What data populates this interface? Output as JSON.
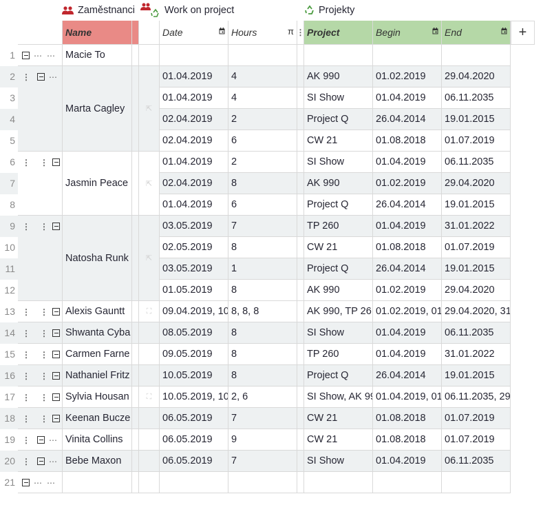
{
  "sections": {
    "employees": "Zaměstnanci",
    "work": "Work on project",
    "projects": "Projekty"
  },
  "columns": {
    "name": "Name",
    "date": "Date",
    "hours": "Hours",
    "hours_type": "π",
    "project": "Project",
    "begin": "Begin",
    "end": "End"
  },
  "add_column": "+",
  "rows": [
    {
      "num": "1",
      "name": "Macie To"
    },
    {
      "num": "2",
      "name": "Marta Cagley"
    },
    {
      "num": "3"
    },
    {
      "num": "4"
    },
    {
      "num": "5"
    },
    {
      "num": "6",
      "name": "Jasmin Peace"
    },
    {
      "num": "7"
    },
    {
      "num": "8"
    },
    {
      "num": "9",
      "name": "Natosha Runk"
    },
    {
      "num": "10"
    },
    {
      "num": "11"
    },
    {
      "num": "12"
    },
    {
      "num": "13",
      "name": "Alexis Gauntt"
    },
    {
      "num": "14",
      "name": "Shwanta Cyba"
    },
    {
      "num": "15",
      "name": "Carmen Farne"
    },
    {
      "num": "16",
      "name": "Nathaniel Fritz"
    },
    {
      "num": "17",
      "name": "Sylvia Housan"
    },
    {
      "num": "18",
      "name": "Keenan Bucze"
    },
    {
      "num": "19",
      "name": "Vinita Collins"
    },
    {
      "num": "20",
      "name": "Bebe Maxon"
    },
    {
      "num": "21"
    }
  ],
  "work": [
    {
      "date": "",
      "hours": ""
    },
    {
      "date": "01.04.2019",
      "hours": "4"
    },
    {
      "date": "01.04.2019",
      "hours": "4"
    },
    {
      "date": "02.04.2019",
      "hours": "2"
    },
    {
      "date": "02.04.2019",
      "hours": "6"
    },
    {
      "date": "01.04.2019",
      "hours": "2"
    },
    {
      "date": "02.04.2019",
      "hours": "8"
    },
    {
      "date": "01.04.2019",
      "hours": "6"
    },
    {
      "date": "03.05.2019",
      "hours": "7"
    },
    {
      "date": "02.05.2019",
      "hours": "8"
    },
    {
      "date": "03.05.2019",
      "hours": "1"
    },
    {
      "date": "01.05.2019",
      "hours": "8"
    },
    {
      "date": "09.04.2019, 10",
      "hours": "8, 8, 8"
    },
    {
      "date": "08.05.2019",
      "hours": "8"
    },
    {
      "date": "09.05.2019",
      "hours": "8"
    },
    {
      "date": "10.05.2019",
      "hours": "8"
    },
    {
      "date": "10.05.2019, 10",
      "hours": "2, 6"
    },
    {
      "date": "06.05.2019",
      "hours": "7"
    },
    {
      "date": "06.05.2019",
      "hours": "9"
    },
    {
      "date": "06.05.2019",
      "hours": "7"
    },
    {
      "date": "",
      "hours": ""
    }
  ],
  "projects": [
    {
      "project": "",
      "begin": "",
      "end": ""
    },
    {
      "project": "AK 990",
      "begin": "01.02.2019",
      "end": "29.04.2020"
    },
    {
      "project": "SI Show",
      "begin": "01.04.2019",
      "end": "06.11.2035"
    },
    {
      "project": "Project Q",
      "begin": "26.04.2014",
      "end": "19.01.2015"
    },
    {
      "project": "CW 21",
      "begin": "01.08.2018",
      "end": "01.07.2019"
    },
    {
      "project": "SI Show",
      "begin": "01.04.2019",
      "end": "06.11.2035"
    },
    {
      "project": "AK 990",
      "begin": "01.02.2019",
      "end": "29.04.2020"
    },
    {
      "project": "Project Q",
      "begin": "26.04.2014",
      "end": "19.01.2015"
    },
    {
      "project": "TP 260",
      "begin": "01.04.2019",
      "end": "31.01.2022"
    },
    {
      "project": "CW 21",
      "begin": "01.08.2018",
      "end": "01.07.2019"
    },
    {
      "project": "Project Q",
      "begin": "26.04.2014",
      "end": "19.01.2015"
    },
    {
      "project": "AK 990",
      "begin": "01.02.2019",
      "end": "29.04.2020"
    },
    {
      "project": "AK 990, TP 26",
      "begin": "01.02.2019, 01",
      "end": "29.04.2020, 31"
    },
    {
      "project": "SI Show",
      "begin": "01.04.2019",
      "end": "06.11.2035"
    },
    {
      "project": "TP 260",
      "begin": "01.04.2019",
      "end": "31.01.2022"
    },
    {
      "project": "Project Q",
      "begin": "26.04.2014",
      "end": "19.01.2015"
    },
    {
      "project": "SI Show, AK 99",
      "begin": "01.04.2019, 01",
      "end": "06.11.2035, 29"
    },
    {
      "project": "CW 21",
      "begin": "01.08.2018",
      "end": "01.07.2019"
    },
    {
      "project": "CW 21",
      "begin": "01.08.2018",
      "end": "01.07.2019"
    },
    {
      "project": "SI Show",
      "begin": "01.04.2019",
      "end": "06.11.2035"
    },
    {
      "project": "",
      "begin": "",
      "end": ""
    }
  ]
}
